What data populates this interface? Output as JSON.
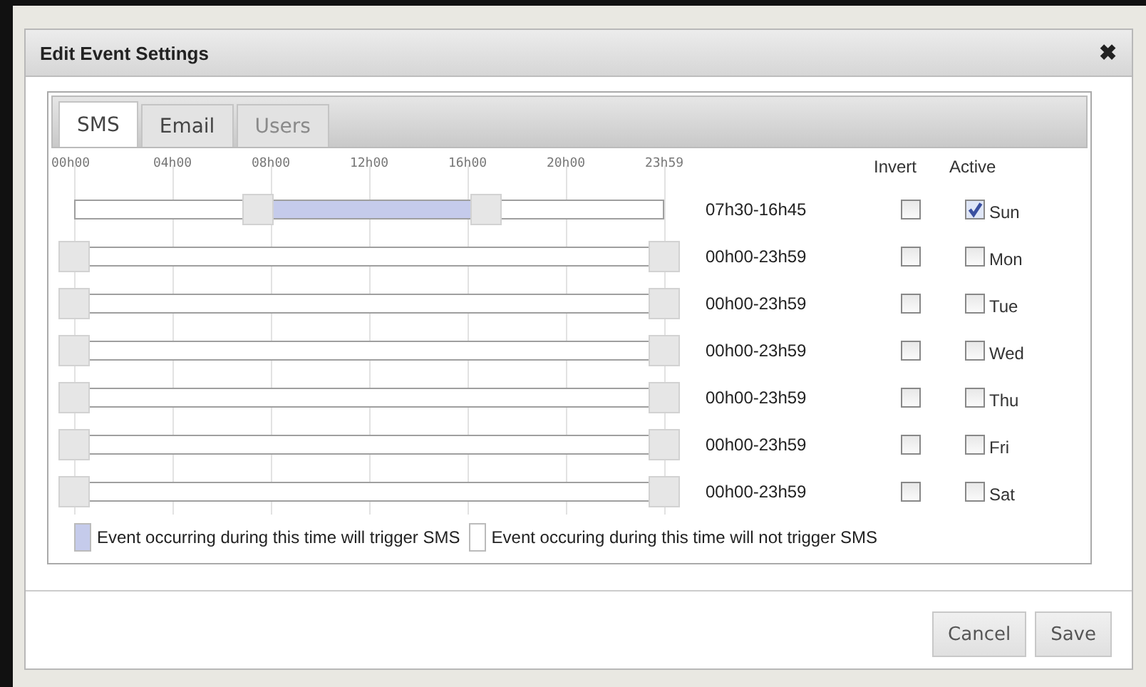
{
  "dialog": {
    "title": "Edit Event Settings",
    "close": "✖"
  },
  "tabs": [
    {
      "label": "SMS",
      "selected": true,
      "disabled": false
    },
    {
      "label": "Email",
      "selected": false,
      "disabled": false
    },
    {
      "label": "Users",
      "selected": false,
      "disabled": true
    }
  ],
  "axis_labels": [
    "00h00",
    "04h00",
    "08h00",
    "12h00",
    "16h00",
    "20h00",
    "23h59"
  ],
  "headers": {
    "invert": "Invert",
    "active": "Active"
  },
  "rows": [
    {
      "start": {
        "level": 0.3125
      },
      "end": {
        "level": 0.6979
      },
      "range": "07h30-16h45",
      "invert": false,
      "active": true,
      "day": "Sun"
    },
    {
      "start": {
        "level": 0
      },
      "end": {
        "level": 1
      },
      "range": "00h00-23h59",
      "invert": false,
      "active": false,
      "day": "Mon"
    },
    {
      "start": {
        "level": 0
      },
      "end": {
        "level": 1
      },
      "range": "00h00-23h59",
      "invert": false,
      "active": false,
      "day": "Tue"
    },
    {
      "start": {
        "level": 0
      },
      "end": {
        "level": 1
      },
      "range": "00h00-23h59",
      "invert": false,
      "active": false,
      "day": "Wed"
    },
    {
      "start": {
        "level": 0
      },
      "end": {
        "level": 1
      },
      "range": "00h00-23h59",
      "invert": false,
      "active": false,
      "day": "Thu"
    },
    {
      "start": {
        "level": 0
      },
      "end": {
        "level": 1
      },
      "range": "00h00-23h59",
      "invert": false,
      "active": false,
      "day": "Fri"
    },
    {
      "start": {
        "level": 0
      },
      "end": {
        "level": 1
      },
      "range": "00h00-23h59",
      "invert": false,
      "active": false,
      "day": "Sat"
    }
  ],
  "legend": [
    {
      "text": "Event occurring during this time will trigger SMS",
      "color": "#c5cbeb"
    },
    {
      "text": "Event occuring during this time will not trigger SMS",
      "color": "#ffffff"
    }
  ],
  "buttons": [
    "Cancel",
    "Save"
  ]
}
